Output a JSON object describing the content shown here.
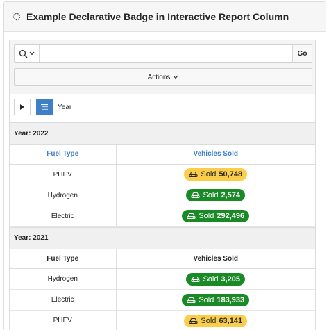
{
  "region": {
    "title": "Example Declarative Badge in Interactive Report Column"
  },
  "toolbar": {
    "search_placeholder": "",
    "go_label": "Go",
    "actions_label": "Actions"
  },
  "controls": {
    "group_label": "Year"
  },
  "groups": [
    {
      "header": "Year: 2022",
      "columns": [
        "Fuel Type",
        "Vehicles Sold"
      ],
      "rows": [
        {
          "fuel": "PHEV",
          "badge_prefix": "Sold",
          "badge_value": "50,748",
          "status": "warning"
        },
        {
          "fuel": "Hydrogen",
          "badge_prefix": "Sold",
          "badge_value": "2,574",
          "status": "success"
        },
        {
          "fuel": "Electric",
          "badge_prefix": "Sold",
          "badge_value": "292,496",
          "status": "success"
        }
      ]
    },
    {
      "header": "Year: 2021",
      "columns": [
        "Fuel Type",
        "Vehicles Sold"
      ],
      "rows": [
        {
          "fuel": "Hydrogen",
          "badge_prefix": "Sold",
          "badge_value": "3,205",
          "status": "success"
        },
        {
          "fuel": "Electric",
          "badge_prefix": "Sold",
          "badge_value": "183,933",
          "status": "success"
        },
        {
          "fuel": "PHEV",
          "badge_prefix": "Sold",
          "badge_value": "63,141",
          "status": "warning"
        }
      ]
    }
  ],
  "colors": {
    "accent": "#3e7fc6",
    "badge_warning": "#fbce4a",
    "badge_success": "#1a8a26"
  },
  "icons": {
    "region": "circle-icon",
    "search": "search-icon",
    "badge": "car-icon"
  }
}
